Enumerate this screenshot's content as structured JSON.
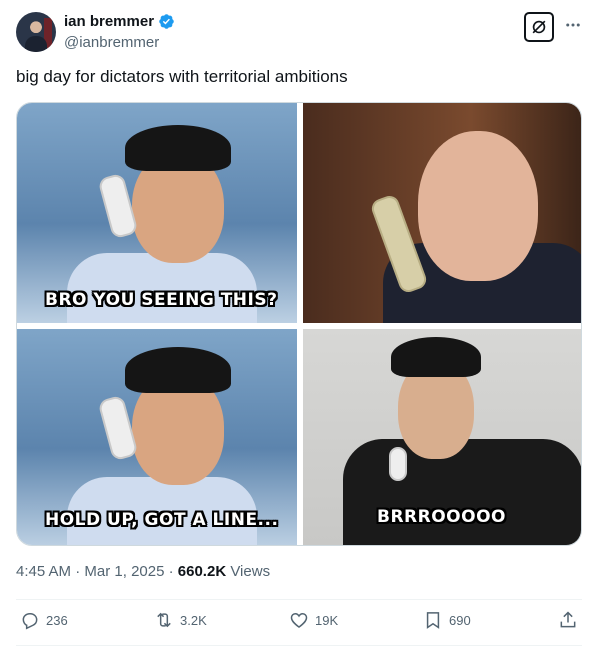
{
  "author": {
    "display_name": "ian bremmer",
    "handle": "@ianbremmer",
    "verified": true
  },
  "tweet": {
    "text": "big day for dictators with territorial ambitions"
  },
  "media": {
    "panels": [
      {
        "caption": "BRO YOU SEEING THIS?"
      },
      {
        "caption": ""
      },
      {
        "caption": "HOLD UP, GOT A LINE..."
      },
      {
        "caption": "BRRROOOOO"
      }
    ]
  },
  "meta": {
    "time": "4:45 AM",
    "separator": "·",
    "date": "Mar 1, 2025",
    "views_count": "660.2K",
    "views_label": "Views"
  },
  "actions": {
    "reply_count": "236",
    "repost_count": "3.2K",
    "like_count": "19K",
    "bookmark_count": "690"
  },
  "colors": {
    "verified": "#1d9bf0",
    "text": "#0f1419",
    "secondary": "#536471"
  },
  "icons": [
    "verified-badge-icon",
    "grok-icon",
    "more-icon",
    "reply-icon",
    "repost-icon",
    "like-icon",
    "bookmark-icon",
    "share-icon"
  ]
}
